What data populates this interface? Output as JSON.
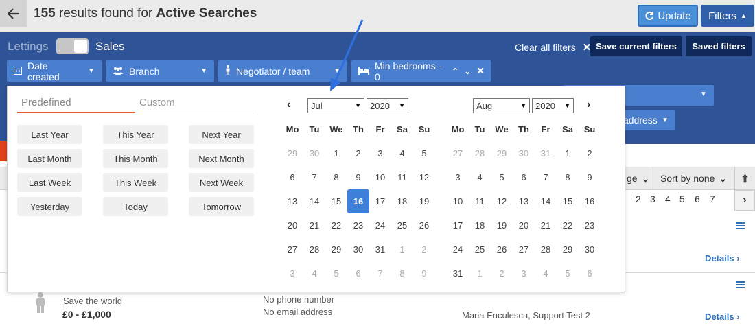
{
  "header": {
    "count": "155",
    "results_text": " results found for ",
    "search_name": "Active Searches",
    "update_label": "Update",
    "filters_label": "Filters"
  },
  "filterbar": {
    "lettings_label": "Lettings",
    "sales_label": "Sales",
    "clear_all_label": "Clear all filters",
    "save_current_label": "Save current filters",
    "saved_filters_label": "Saved filters",
    "chips": [
      {
        "label": "Date created"
      },
      {
        "label": "Branch"
      },
      {
        "label": "Negotiator / team"
      },
      {
        "label": "Min bedrooms - 0"
      }
    ],
    "address_label": "address"
  },
  "table": {
    "sort_age_label": "ge",
    "sort_by_label": "Sort by none",
    "pages": [
      "2",
      "3",
      "4",
      "5",
      "6",
      "7"
    ],
    "details_label": "Details",
    "row2": {
      "subtitle": "Save the world",
      "price": "£0 - £1,000",
      "phone": "No phone number",
      "email": "No email address",
      "agents": "Maria Enculescu, Support Test 2"
    }
  },
  "datepicker": {
    "tabs": {
      "predefined": "Predefined",
      "custom": "Custom"
    },
    "presets": [
      [
        "Last Year",
        "This Year",
        "Next Year"
      ],
      [
        "Last Month",
        "This Month",
        "Next Month"
      ],
      [
        "Last Week",
        "This Week",
        "Next Week"
      ],
      [
        "Yesterday",
        "Today",
        "Tomorrow"
      ]
    ],
    "weekdays": [
      "Mo",
      "Tu",
      "We",
      "Th",
      "Fr",
      "Sa",
      "Su"
    ],
    "left": {
      "month": "Jul",
      "year": "2020",
      "weeks": [
        [
          "29",
          "30",
          "1",
          "2",
          "3",
          "4",
          "5"
        ],
        [
          "6",
          "7",
          "8",
          "9",
          "10",
          "11",
          "12"
        ],
        [
          "13",
          "14",
          "15",
          "16",
          "17",
          "18",
          "19"
        ],
        [
          "20",
          "21",
          "22",
          "23",
          "24",
          "25",
          "26"
        ],
        [
          "27",
          "28",
          "29",
          "30",
          "31",
          "1",
          "2"
        ],
        [
          "3",
          "4",
          "5",
          "6",
          "7",
          "8",
          "9"
        ]
      ],
      "muted_before": 2,
      "muted_after_index": 33,
      "selected": "16"
    },
    "right": {
      "month": "Aug",
      "year": "2020",
      "weeks": [
        [
          "27",
          "28",
          "29",
          "30",
          "31",
          "1",
          "2"
        ],
        [
          "3",
          "4",
          "5",
          "6",
          "7",
          "8",
          "9"
        ],
        [
          "10",
          "11",
          "12",
          "13",
          "14",
          "15",
          "16"
        ],
        [
          "17",
          "18",
          "19",
          "20",
          "21",
          "22",
          "23"
        ],
        [
          "24",
          "25",
          "26",
          "27",
          "28",
          "29",
          "30"
        ],
        [
          "31",
          "1",
          "2",
          "3",
          "4",
          "5",
          "6"
        ]
      ],
      "muted_before": 5,
      "muted_after_index": 36
    }
  },
  "colors": {
    "filterbar": "#2f5397",
    "chip": "#4a7fcf",
    "accent": "#3d7fd9",
    "active_tab_underline": "#e65c2e"
  }
}
